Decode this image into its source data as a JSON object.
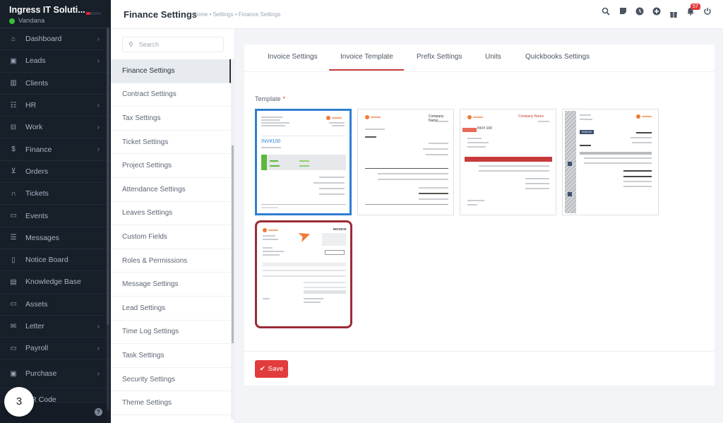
{
  "sidebar": {
    "company": "Ingress IT Soluti...",
    "user": "Vandana",
    "status_color": "#39c136",
    "items": [
      {
        "label": "Dashboard",
        "icon": "house-icon",
        "glyph": "⌂",
        "chevron": true
      },
      {
        "label": "Leads",
        "icon": "id-card-icon",
        "glyph": "▣",
        "chevron": true
      },
      {
        "label": "Clients",
        "icon": "building-icon",
        "glyph": "▥",
        "chevron": false
      },
      {
        "label": "HR",
        "icon": "people-icon",
        "glyph": "☷",
        "chevron": true
      },
      {
        "label": "Work",
        "icon": "briefcase-icon",
        "glyph": "⊟",
        "chevron": true
      },
      {
        "label": "Finance",
        "icon": "dollar-icon",
        "glyph": "$",
        "chevron": true
      },
      {
        "label": "Orders",
        "icon": "cart-icon",
        "glyph": "⊻",
        "chevron": false
      },
      {
        "label": "Tickets",
        "icon": "headset-icon",
        "glyph": "∩",
        "chevron": false
      },
      {
        "label": "Events",
        "icon": "calendar-icon",
        "glyph": "▭",
        "chevron": false
      },
      {
        "label": "Messages",
        "icon": "chat-icon",
        "glyph": "☰",
        "chevron": false
      },
      {
        "label": "Notice Board",
        "icon": "clipboard-icon",
        "glyph": "▯",
        "chevron": false
      },
      {
        "label": "Knowledge Base",
        "icon": "document-icon",
        "glyph": "▤",
        "chevron": false
      },
      {
        "label": "Assets",
        "icon": "monitor-icon",
        "glyph": "▭",
        "chevron": false
      },
      {
        "label": "Letter",
        "icon": "envelope-icon",
        "glyph": "✉",
        "chevron": true
      },
      {
        "label": "Payroll",
        "icon": "wallet-icon",
        "glyph": "▭",
        "chevron": true
      },
      {
        "label": "Purchase",
        "icon": "receipt-icon",
        "glyph": "▣",
        "chevron": true
      },
      {
        "label": "QR Code",
        "icon": "qr-icon",
        "glyph": "▦",
        "chevron": false
      }
    ],
    "step_badge": "3",
    "help": "?"
  },
  "header": {
    "title": "Finance Settings",
    "breadcrumb": "Home • Settings • Finance Settings",
    "notification_count": "57"
  },
  "settings_menu": {
    "search_placeholder": "Search",
    "items": [
      "Finance Settings",
      "Contract Settings",
      "Tax Settings",
      "Ticket Settings",
      "Project Settings",
      "Attendance Settings",
      "Leaves Settings",
      "Custom Fields",
      "Roles & Permissions",
      "Message Settings",
      "Lead Settings",
      "Time Log Settings",
      "Task Settings",
      "Security Settings",
      "Theme Settings"
    ],
    "active_index": 0
  },
  "main": {
    "tabs": [
      "Invoice Settings",
      "Invoice Template",
      "Prefix Settings",
      "Units",
      "Quickbooks Settings"
    ],
    "active_tab": 1,
    "field_label": "Template",
    "required_mark": "*",
    "templates": [
      {
        "name": "invoice-1",
        "selected": true,
        "accent": "#5cb83c",
        "invoice_no": "INV#100"
      },
      {
        "name": "invoice-2",
        "selected": false,
        "accent": "#333333",
        "title": "Company Name"
      },
      {
        "name": "invoice-3",
        "selected": false,
        "accent": "#c7393a",
        "title": "Company Name",
        "invoice_no": "INV# 100"
      },
      {
        "name": "invoice-4",
        "selected": false,
        "accent": "#3d4f6e",
        "invoice_no": "INV#100"
      },
      {
        "name": "invoice-5",
        "selected": false,
        "hover": true,
        "accent": "#f07b39",
        "title": "INVOICE"
      }
    ],
    "save_label": "Save"
  },
  "colors": {
    "accent_red": "#e23d3d",
    "selected_blue": "#2f7fd2",
    "sidebar_bg": "#171f29"
  }
}
